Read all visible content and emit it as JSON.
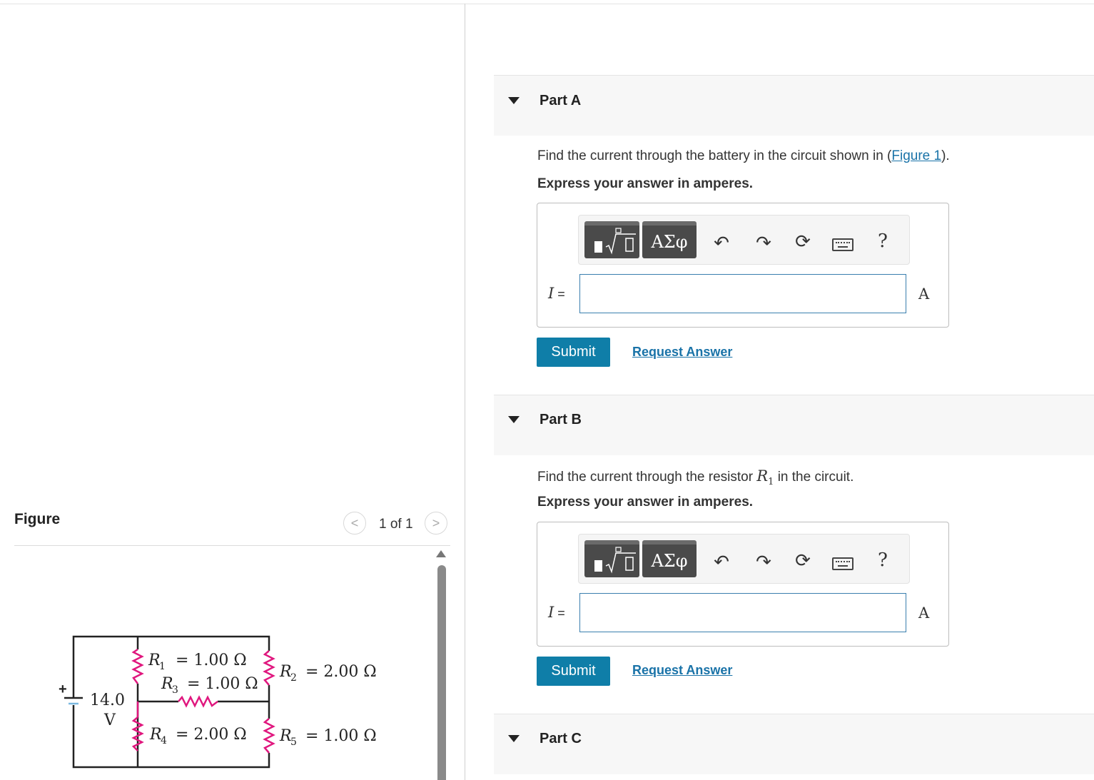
{
  "figure": {
    "title": "Figure",
    "pager": {
      "text": "1 of 1",
      "prev": "<",
      "next": ">"
    },
    "circuit": {
      "battery_voltage": "14.0",
      "battery_unit": "V",
      "plus": "+",
      "r1": {
        "name": "R",
        "sub": "1",
        "value": "= 1.00 Ω"
      },
      "r2": {
        "name": "R",
        "sub": "2",
        "value": "= 2.00 Ω"
      },
      "r3": {
        "name": "R",
        "sub": "3",
        "value": "= 1.00 Ω"
      },
      "r4": {
        "name": "R",
        "sub": "4",
        "value": "= 2.00 Ω"
      },
      "r5": {
        "name": "R",
        "sub": "5",
        "value": "= 1.00 Ω"
      }
    }
  },
  "parts": {
    "a": {
      "title": "Part A",
      "prompt_before": "Find the current through the battery in the circuit shown in (",
      "prompt_link": "Figure 1",
      "prompt_after": ").",
      "express": "Express your answer in amperes.",
      "var_label": "I",
      "eq": " =",
      "unit": "A",
      "submit": "Submit",
      "request": "Request Answer",
      "toolbar": {
        "greek": "ΑΣφ",
        "help": "?"
      }
    },
    "b": {
      "title": "Part B",
      "prompt_before": "Find the current through the resistor ",
      "prompt_math": "R",
      "prompt_math_sub": "1",
      "prompt_after": " in the circuit.",
      "express": "Express your answer in amperes.",
      "var_label": "I",
      "eq": " =",
      "unit": "A",
      "submit": "Submit",
      "request": "Request Answer",
      "toolbar": {
        "greek": "ΑΣφ",
        "help": "?"
      }
    },
    "c": {
      "title": "Part C"
    }
  },
  "colors": {
    "accent": "#0f7ea8",
    "link": "#1a73a8",
    "resistor": "#e0177e"
  }
}
